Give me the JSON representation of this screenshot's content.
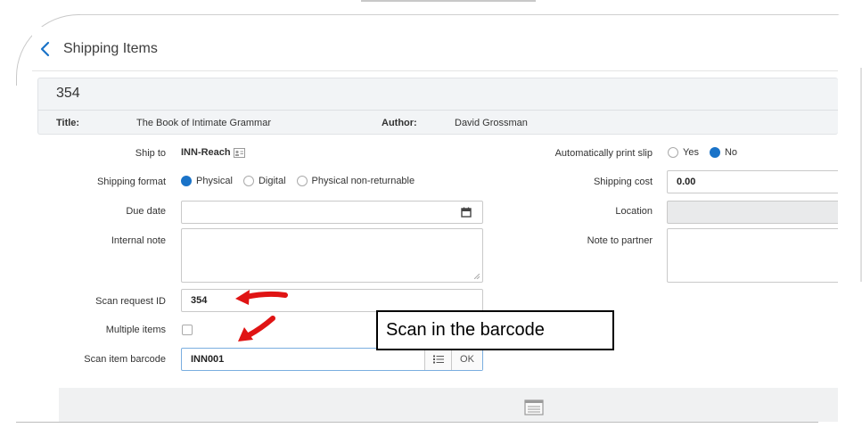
{
  "header": {
    "title": "Shipping Items"
  },
  "item": {
    "id": "354",
    "title_label": "Title:",
    "title_value": "The Book of Intimate Grammar",
    "author_label": "Author:",
    "author_value": "David Grossman"
  },
  "form": {
    "ship_to": {
      "label": "Ship to",
      "value": "INN-Reach"
    },
    "shipping_format": {
      "label": "Shipping format",
      "options": [
        "Physical",
        "Digital",
        "Physical non-returnable"
      ],
      "selected": "Physical"
    },
    "due_date": {
      "label": "Due date",
      "value": ""
    },
    "internal_note": {
      "label": "Internal note",
      "value": ""
    },
    "scan_request_id": {
      "label": "Scan request ID",
      "value": "354"
    },
    "multiple_items": {
      "label": "Multiple items",
      "checked": false
    },
    "scan_item_barcode": {
      "label": "Scan item barcode",
      "value": "INN001",
      "ok_label": "OK"
    },
    "auto_print_slip": {
      "label": "Automatically print slip",
      "options": [
        "Yes",
        "No"
      ],
      "selected": "No"
    },
    "shipping_cost": {
      "label": "Shipping cost",
      "value": "0.00"
    },
    "location": {
      "label": "Location",
      "value": ""
    },
    "note_to_partner": {
      "label": "Note to partner",
      "value": ""
    }
  },
  "annotation": {
    "callout_text": "Scan in the barcode"
  },
  "colors": {
    "accent": "#1a73c8",
    "arrow": "#e01414",
    "card_bg": "#f2f4f6"
  }
}
